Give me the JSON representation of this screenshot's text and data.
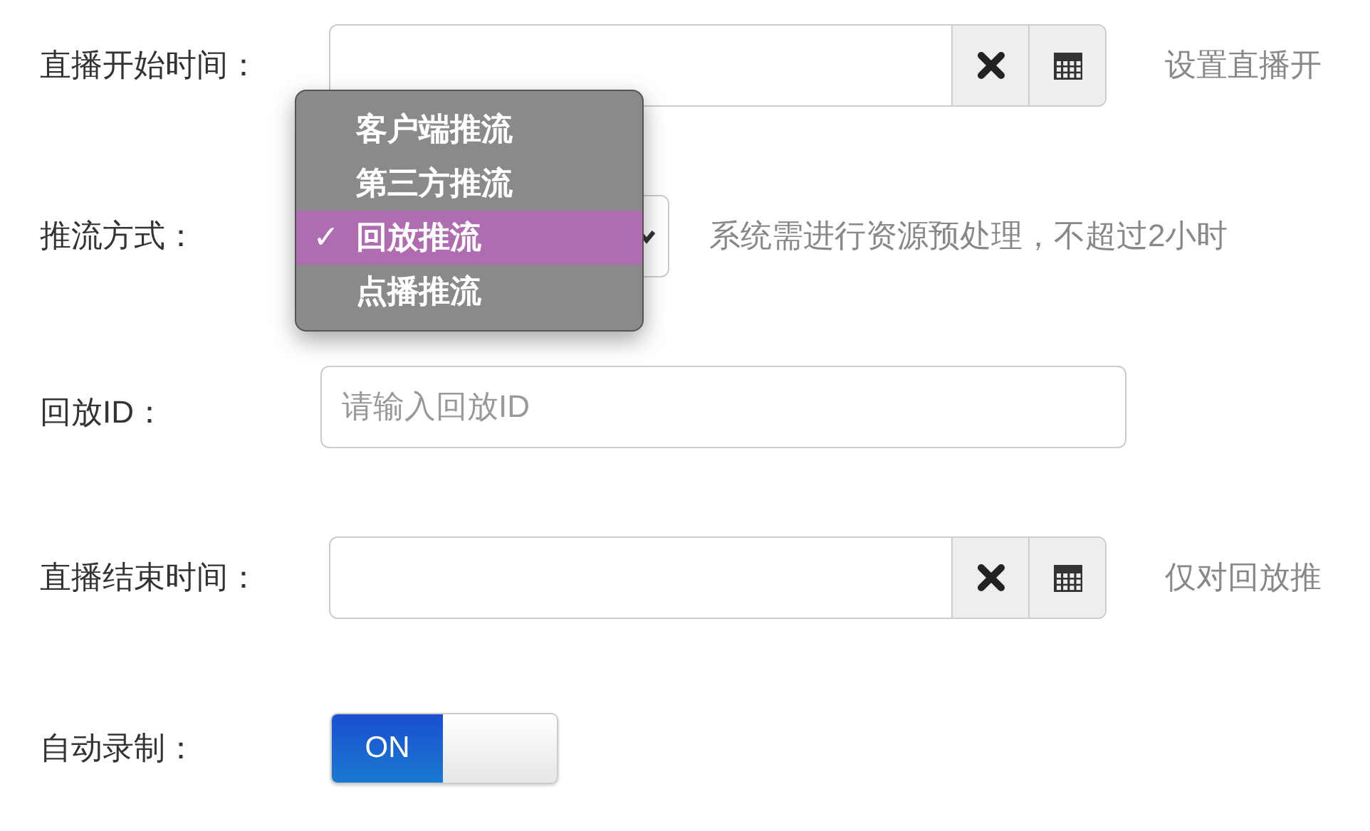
{
  "fields": [
    {
      "kind": "datetime",
      "label": "直播开始时间：",
      "hint": "设置直播开"
    },
    {
      "kind": "select",
      "label": "推流方式：",
      "hint": "系统需进行资源预处理，不超过2小时",
      "options": [
        {
          "label": "客户端推流",
          "selected": false
        },
        {
          "label": "第三方推流",
          "selected": false
        },
        {
          "label": "回放推流",
          "selected": true
        },
        {
          "label": "点播推流",
          "selected": false
        }
      ],
      "check": "✓"
    },
    {
      "kind": "text",
      "label": "回放ID：",
      "placeholder": "请输入回放ID"
    },
    {
      "kind": "datetime",
      "label": "直播结束时间：",
      "hint": "仅对回放推"
    },
    {
      "kind": "toggle",
      "label": "自动录制：",
      "on": true,
      "on_label": "ON"
    }
  ]
}
